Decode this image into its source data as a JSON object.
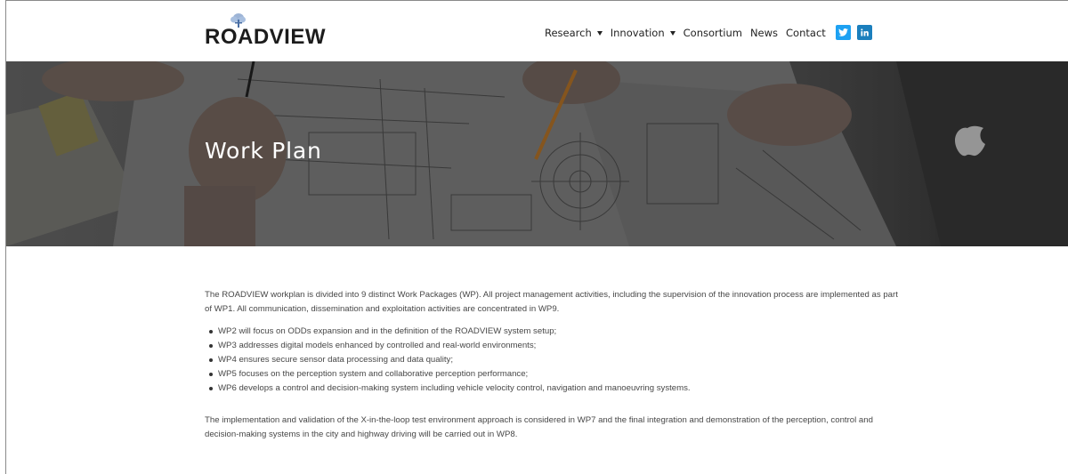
{
  "header": {
    "logo_text": "ROADVIEW",
    "nav": [
      {
        "label": "Research",
        "has_dropdown": true
      },
      {
        "label": "Innovation",
        "has_dropdown": true
      },
      {
        "label": "Consortium",
        "has_dropdown": false
      },
      {
        "label": "News",
        "has_dropdown": false
      },
      {
        "label": "Contact",
        "has_dropdown": false
      }
    ],
    "social": [
      "twitter-icon",
      "linkedin-icon"
    ]
  },
  "hero": {
    "title": "Work Plan"
  },
  "content": {
    "intro": "The ROADVIEW workplan is divided into 9 distinct Work Packages (WP). All project management activities, including the supervision of the innovation process are implemented as part of WP1. All communication, dissemination and exploitation activities are concentrated in WP9.",
    "bullets": [
      "WP2 will focus on ODDs expansion and in the definition of the ROADVIEW system setup;",
      "WP3 addresses digital models enhanced by controlled and real-world environments;",
      "WP4 ensures secure sensor data processing and data quality;",
      "WP5 focuses on the perception system and collaborative perception performance;",
      "WP6 develops a control and decision-making system including vehicle velocity control, navigation and manoeuvring systems."
    ],
    "outro": "The implementation and validation of the X-in-the-loop test environment approach is considered in WP7 and the final integration and demonstration of the perception, control and decision-making systems in the city and highway driving will be carried out in WP8."
  },
  "colors": {
    "twitter": "#1da1f2",
    "linkedin": "#1b7fbd",
    "hero_overlay": "#3c3c3c"
  }
}
